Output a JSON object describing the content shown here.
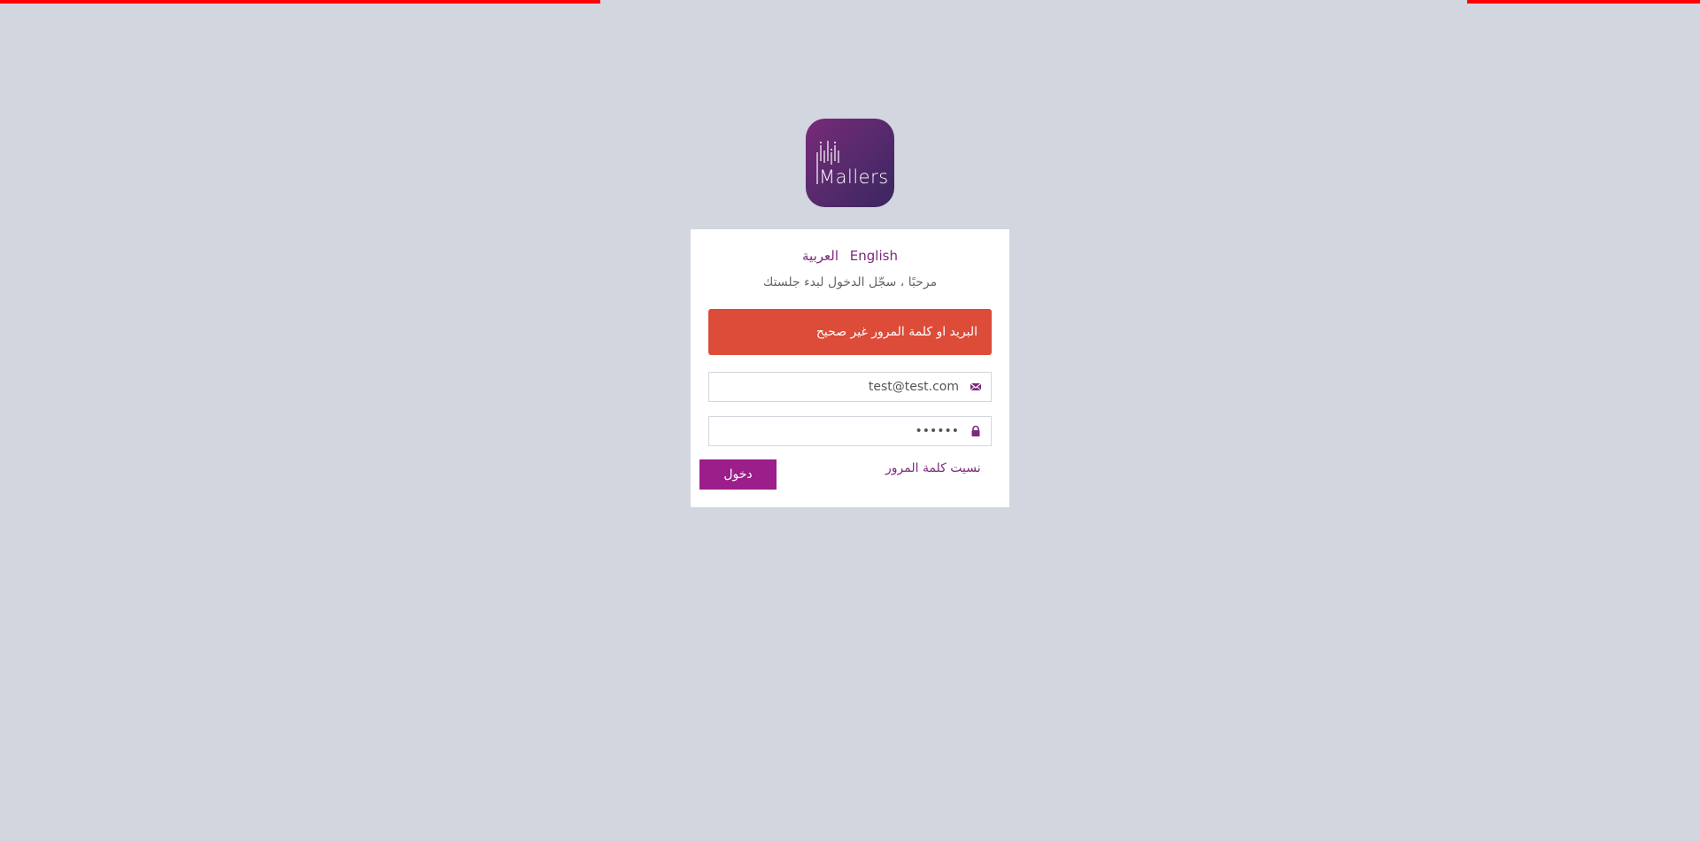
{
  "logo": {
    "text": "Mallers",
    "colors": [
      "#7a2a78",
      "#3a2660"
    ]
  },
  "languages": {
    "english": "English",
    "arabic": "العربية"
  },
  "welcome_text": "مرحبًا ، سجّل الدخول لبدء جلستك",
  "error_alert": "البريد او كلمة المرور غير صحيح",
  "email_field": {
    "value": "test@test.com",
    "icon": "envelope-icon"
  },
  "password_field": {
    "value": "••••••",
    "icon": "lock-icon"
  },
  "forgot_password_link": "نسيت كلمة المرور",
  "login_button": "دخول",
  "colors": {
    "accent": "#9c1e8a",
    "link": "#7b2a7b",
    "error": "#dd4b39",
    "background": "#d2d6de",
    "progress": "#ff0000"
  }
}
